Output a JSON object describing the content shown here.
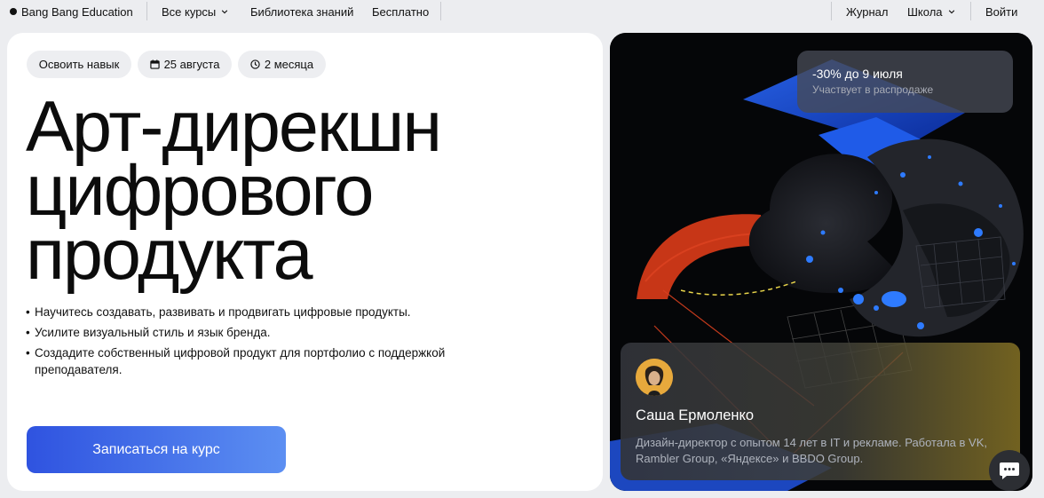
{
  "nav": {
    "logo": "Bang Bang Education",
    "items": [
      "Все курсы",
      "Библиотека знаний",
      "Бесплатно"
    ],
    "right_items": [
      "Журнал",
      "Школа",
      "Войти"
    ]
  },
  "hero": {
    "chips": [
      "Освоить навык",
      "25 августа",
      "2 месяца"
    ],
    "title_lines": [
      "Арт-дирекшн",
      "цифрового",
      "продукта"
    ],
    "bullets": [
      "Научитесь создавать, развивать и продвигать цифровые продукты.",
      "Усилите визуальный стиль и язык бренда.",
      "Создадите собственный цифровой продукт для портфолио с поддержкой преподавателя."
    ],
    "cta": "Записаться на курс"
  },
  "sale": {
    "title": "-30% до 9 июля",
    "subtitle": "Участвует в распродаже"
  },
  "mentor": {
    "name": "Саша Ермоленко",
    "description": "Дизайн-директор с опытом 14 лет в IT и рекламе. Работала в VK, Rambler Group, «Яндексе» и BBDO Group."
  },
  "icons": {
    "calendar": "calendar-icon",
    "clock": "clock-icon",
    "chevron": "chevron-down-icon",
    "chat": "chat-icon"
  },
  "colors": {
    "cta_start": "#2f53e0",
    "cta_end": "#5c8ff2",
    "page_bg": "#ecedf0",
    "accent_blue": "#1f5be8",
    "accent_orange": "#d9401f"
  }
}
